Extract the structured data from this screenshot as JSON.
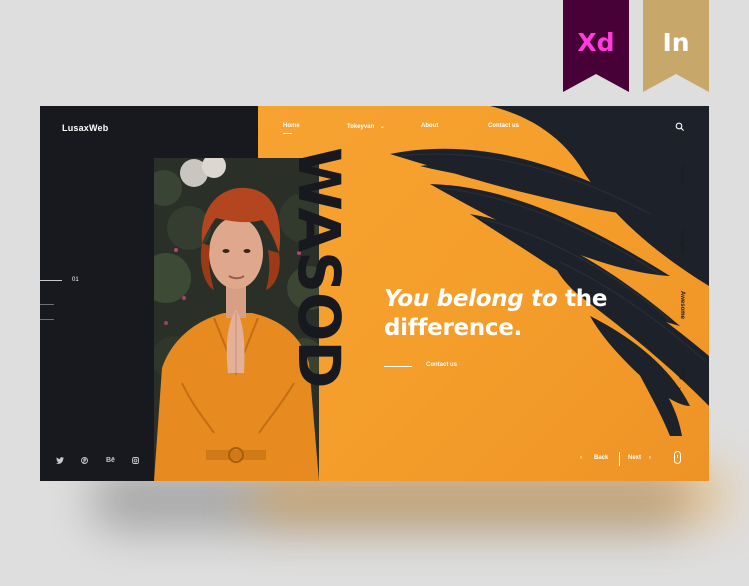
{
  "badges": {
    "xd": "Xd",
    "in": "In"
  },
  "brand": {
    "logo": "LusaxWeb"
  },
  "nav": {
    "items": [
      {
        "label": "Home",
        "active": true
      },
      {
        "label": "Tokeyvan",
        "has_dropdown": true
      },
      {
        "label": "About"
      },
      {
        "label": "Contact us"
      }
    ]
  },
  "side_nav": {
    "items": [
      "Brand",
      "Designer",
      "Awesome",
      "Dog"
    ]
  },
  "hero": {
    "big_word": "WASOD",
    "tagline_italic": "You belong to",
    "tagline_rest": " the difference.",
    "cta_label": "Contact us",
    "slide_number": "01"
  },
  "social": {
    "behance": "Bē"
  },
  "pager": {
    "back": "Back",
    "next": "Next"
  },
  "colors": {
    "orange": "#f49d2b",
    "dark": "#17191f",
    "xd_pink": "#ff3bdc",
    "in_gold": "#c8a86a"
  },
  "icons": [
    "search-icon",
    "chevron-down-icon",
    "twitter-icon",
    "pinterest-icon",
    "behance-icon",
    "instagram-icon",
    "chevron-left-icon",
    "chevron-right-icon",
    "mouse-scroll-icon"
  ]
}
